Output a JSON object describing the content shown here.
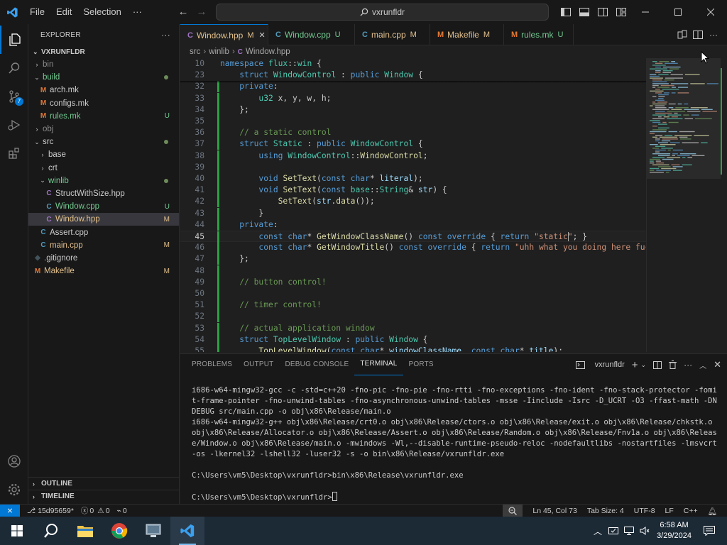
{
  "titlebar": {
    "menu": [
      "File",
      "Edit",
      "Selection",
      "···"
    ],
    "search": "vxrunfldr"
  },
  "activity_bar": {
    "source_control_badge": "7"
  },
  "sidebar": {
    "header": "EXPLORER",
    "more": "···",
    "root": "VXRUNFLDR",
    "tree": [
      {
        "name": "bin",
        "type": "folder",
        "depth": 1,
        "open": false,
        "status": "",
        "color": "gray"
      },
      {
        "name": "build",
        "type": "folder",
        "depth": 1,
        "open": true,
        "status": "dot",
        "color": "unt"
      },
      {
        "name": "arch.mk",
        "type": "m",
        "depth": 2,
        "status": "",
        "color": "plain"
      },
      {
        "name": "configs.mk",
        "type": "m",
        "depth": 2,
        "status": "",
        "color": "plain"
      },
      {
        "name": "rules.mk",
        "type": "m",
        "depth": 2,
        "status": "U",
        "color": "unt"
      },
      {
        "name": "obj",
        "type": "folder",
        "depth": 1,
        "open": false,
        "status": "",
        "color": "gray"
      },
      {
        "name": "src",
        "type": "folder",
        "depth": 1,
        "open": true,
        "status": "dot",
        "color": "plain"
      },
      {
        "name": "base",
        "type": "folder",
        "depth": 2,
        "open": false,
        "status": "",
        "color": "plain"
      },
      {
        "name": "crt",
        "type": "folder",
        "depth": 2,
        "open": false,
        "status": "",
        "color": "plain"
      },
      {
        "name": "winlib",
        "type": "folder",
        "depth": 2,
        "open": true,
        "status": "dot",
        "color": "unt"
      },
      {
        "name": "StructWithSize.hpp",
        "type": "h",
        "depth": 3,
        "status": "",
        "color": "plain"
      },
      {
        "name": "Window.cpp",
        "type": "cpp",
        "depth": 3,
        "status": "U",
        "color": "unt"
      },
      {
        "name": "Window.hpp",
        "type": "h",
        "depth": 3,
        "status": "M",
        "color": "mod",
        "selected": true
      },
      {
        "name": "Assert.cpp",
        "type": "cpp",
        "depth": 2,
        "status": "",
        "color": "plain"
      },
      {
        "name": "main.cpp",
        "type": "cpp",
        "depth": 2,
        "status": "M",
        "color": "mod"
      },
      {
        "name": ".gitignore",
        "type": "git",
        "depth": 1,
        "status": "",
        "color": "plain"
      },
      {
        "name": "Makefile",
        "type": "m",
        "depth": 1,
        "status": "M",
        "color": "mod"
      }
    ],
    "outline": "OUTLINE",
    "timeline": "TIMELINE"
  },
  "tabs": [
    {
      "icon": "h",
      "label": "Window.hpp",
      "status": "M",
      "color": "mod",
      "active": true
    },
    {
      "icon": "cpp",
      "label": "Window.cpp",
      "status": "U",
      "color": "unt"
    },
    {
      "icon": "cpp",
      "label": "main.cpp",
      "status": "M",
      "color": "mod"
    },
    {
      "icon": "m",
      "label": "Makefile",
      "status": "M",
      "color": "mod"
    },
    {
      "icon": "m",
      "label": "rules.mk",
      "status": "U",
      "color": "unt"
    }
  ],
  "breadcrumb": [
    "src",
    "winlib",
    "Window.hpp"
  ],
  "editor": {
    "current_line": "45",
    "lines": [
      {
        "n": "10",
        "sticky": true,
        "tokens": [
          [
            "kw",
            "namespace "
          ],
          [
            "ns",
            "flux"
          ],
          [
            "pl",
            "::"
          ],
          [
            "ns",
            "win"
          ],
          [
            "pl",
            " {"
          ]
        ]
      },
      {
        "n": "23",
        "sticky": true,
        "tokens": [
          [
            "pl",
            "    "
          ],
          [
            "kw",
            "struct "
          ],
          [
            "ty",
            "WindowControl"
          ],
          [
            "pl",
            " : "
          ],
          [
            "kw",
            "public "
          ],
          [
            "ty",
            "Window"
          ],
          [
            "pl",
            " {"
          ]
        ]
      },
      {
        "n": "32",
        "tokens": [
          [
            "pl",
            "    "
          ],
          [
            "kw",
            "private"
          ],
          [
            "pl",
            ":"
          ]
        ]
      },
      {
        "n": "33",
        "tokens": [
          [
            "pl",
            "        "
          ],
          [
            "ty",
            "u32"
          ],
          [
            "pl",
            " x, y, w, h;"
          ]
        ]
      },
      {
        "n": "34",
        "tokens": [
          [
            "pl",
            "    };"
          ]
        ]
      },
      {
        "n": "35",
        "tokens": []
      },
      {
        "n": "36",
        "tokens": [
          [
            "pl",
            "    "
          ],
          [
            "cm",
            "// a static control"
          ]
        ]
      },
      {
        "n": "37",
        "tokens": [
          [
            "pl",
            "    "
          ],
          [
            "kw",
            "struct "
          ],
          [
            "ty",
            "Static"
          ],
          [
            "pl",
            " : "
          ],
          [
            "kw",
            "public "
          ],
          [
            "ty",
            "WindowControl"
          ],
          [
            "pl",
            " {"
          ]
        ]
      },
      {
        "n": "38",
        "tokens": [
          [
            "pl",
            "        "
          ],
          [
            "kw",
            "using "
          ],
          [
            "ty",
            "WindowControl"
          ],
          [
            "pl",
            "::"
          ],
          [
            "fn",
            "WindowControl"
          ],
          [
            "pl",
            ";"
          ]
        ]
      },
      {
        "n": "39",
        "tokens": []
      },
      {
        "n": "40",
        "tokens": [
          [
            "pl",
            "        "
          ],
          [
            "kw",
            "void "
          ],
          [
            "fn",
            "SetText"
          ],
          [
            "pl",
            "("
          ],
          [
            "kw",
            "const "
          ],
          [
            "kw",
            "char"
          ],
          [
            "pl",
            "* "
          ],
          [
            "id",
            "literal"
          ],
          [
            "pl",
            ");"
          ]
        ]
      },
      {
        "n": "41",
        "tokens": [
          [
            "pl",
            "        "
          ],
          [
            "kw",
            "void "
          ],
          [
            "fn",
            "SetText"
          ],
          [
            "pl",
            "("
          ],
          [
            "kw",
            "const "
          ],
          [
            "ns",
            "base"
          ],
          [
            "pl",
            "::"
          ],
          [
            "ty",
            "String"
          ],
          [
            "pl",
            "& "
          ],
          [
            "id",
            "str"
          ],
          [
            "pl",
            ") {"
          ]
        ]
      },
      {
        "n": "42",
        "tokens": [
          [
            "pl",
            "            "
          ],
          [
            "fn",
            "SetText"
          ],
          [
            "pl",
            "("
          ],
          [
            "id",
            "str"
          ],
          [
            "pl",
            "."
          ],
          [
            "fn",
            "data"
          ],
          [
            "pl",
            "());"
          ]
        ]
      },
      {
        "n": "43",
        "tokens": [
          [
            "pl",
            "        }"
          ]
        ]
      },
      {
        "n": "44",
        "tokens": [
          [
            "pl",
            "    "
          ],
          [
            "kw",
            "private"
          ],
          [
            "pl",
            ":"
          ]
        ]
      },
      {
        "n": "45",
        "tokens": [
          [
            "pl",
            "        "
          ],
          [
            "kw",
            "const "
          ],
          [
            "kw",
            "char"
          ],
          [
            "pl",
            "* "
          ],
          [
            "fn",
            "GetWindowClassName"
          ],
          [
            "pl",
            "() "
          ],
          [
            "kw",
            "const "
          ],
          [
            "kw",
            "override"
          ],
          [
            "pl",
            " { "
          ],
          [
            "kw",
            "return "
          ],
          [
            "str",
            "\"static\""
          ],
          [
            "pl",
            "; }"
          ]
        ]
      },
      {
        "n": "46",
        "tokens": [
          [
            "pl",
            "        "
          ],
          [
            "kw",
            "const "
          ],
          [
            "kw",
            "char"
          ],
          [
            "pl",
            "* "
          ],
          [
            "fn",
            "GetWindowTitle"
          ],
          [
            "pl",
            "() "
          ],
          [
            "kw",
            "const "
          ],
          [
            "kw",
            "override"
          ],
          [
            "pl",
            " { "
          ],
          [
            "kw",
            "return "
          ],
          [
            "str",
            "\"uhh what you doing here fucker g"
          ]
        ]
      },
      {
        "n": "47",
        "tokens": [
          [
            "pl",
            "    };"
          ]
        ]
      },
      {
        "n": "48",
        "tokens": []
      },
      {
        "n": "49",
        "tokens": [
          [
            "pl",
            "    "
          ],
          [
            "cm",
            "// button control!"
          ]
        ]
      },
      {
        "n": "50",
        "tokens": []
      },
      {
        "n": "51",
        "tokens": [
          [
            "pl",
            "    "
          ],
          [
            "cm",
            "// timer control!"
          ]
        ]
      },
      {
        "n": "52",
        "tokens": []
      },
      {
        "n": "53",
        "tokens": [
          [
            "pl",
            "    "
          ],
          [
            "cm",
            "// actual application window"
          ]
        ]
      },
      {
        "n": "54",
        "tokens": [
          [
            "pl",
            "    "
          ],
          [
            "kw",
            "struct "
          ],
          [
            "ty",
            "TopLevelWindow"
          ],
          [
            "pl",
            " : "
          ],
          [
            "kw",
            "public "
          ],
          [
            "ty",
            "Window"
          ],
          [
            "pl",
            " {"
          ]
        ]
      },
      {
        "n": "55",
        "tokens": [
          [
            "pl",
            "        "
          ],
          [
            "fn",
            "TopLevelWindow"
          ],
          [
            "pl",
            "("
          ],
          [
            "kw",
            "const "
          ],
          [
            "kw",
            "char"
          ],
          [
            "pl",
            "* "
          ],
          [
            "id",
            "windowClassName"
          ],
          [
            "pl",
            ", "
          ],
          [
            "kw",
            "const "
          ],
          [
            "kw",
            "char"
          ],
          [
            "pl",
            "* "
          ],
          [
            "id",
            "title"
          ],
          [
            "pl",
            ");"
          ]
        ]
      }
    ]
  },
  "panel": {
    "tabs": [
      "PROBLEMS",
      "OUTPUT",
      "DEBUG CONSOLE",
      "TERMINAL",
      "PORTS"
    ],
    "active_tab": "TERMINAL",
    "terminal_name": "vxrunfldr",
    "terminal_lines": [
      "i686-w64-mingw32-gcc -c -std=c++20 -fno-pic -fno-pie -fno-rtti -fno-exceptions -fno-ident -fno-stack-protector -fomit-frame-pointer -fno-unwind-tables -fno-asynchronous-unwind-tables -msse -Iinclude -Isrc -D_UCRT -O3 -ffast-math -DNDEBUG src/main.cpp -o obj\\x86\\Release/main.o",
      "i686-w64-mingw32-g++ obj\\x86\\Release/crt0.o obj\\x86\\Release/ctors.o obj\\x86\\Release/exit.o obj\\x86\\Release/chkstk.o obj\\x86\\Release/Allocator.o obj\\x86\\Release/Assert.o obj\\x86\\Release/Random.o obj\\x86\\Release/Fnv1a.o obj\\x86\\Release/Window.o obj\\x86\\Release/main.o -mwindows -Wl,--disable-runtime-pseudo-reloc -nodefaultlibs -nostartfiles -lmsvcrt-os -lkernel32 -lshell32 -luser32 -s -o bin\\x86\\Release/vxrunfldr.exe",
      "",
      "C:\\Users\\vm5\\Desktop\\vxrunfldr>bin\\x86\\Release\\vxrunfldr.exe",
      ""
    ],
    "prompt": "C:\\Users\\vm5\\Desktop\\vxrunfldr>"
  },
  "statusbar": {
    "branch": "15d95659*",
    "errors": "0",
    "warnings": "0",
    "ports": "0",
    "position": "Ln 45, Col 73",
    "tab_size": "Tab Size: 4",
    "encoding": "UTF-8",
    "eol": "LF",
    "language": "C++"
  },
  "taskbar": {
    "time": "6:58 AM",
    "date": "3/29/2024"
  },
  "colors": {
    "accent": "#0078d4",
    "modified": "#e2c08d",
    "untracked": "#73c991"
  }
}
